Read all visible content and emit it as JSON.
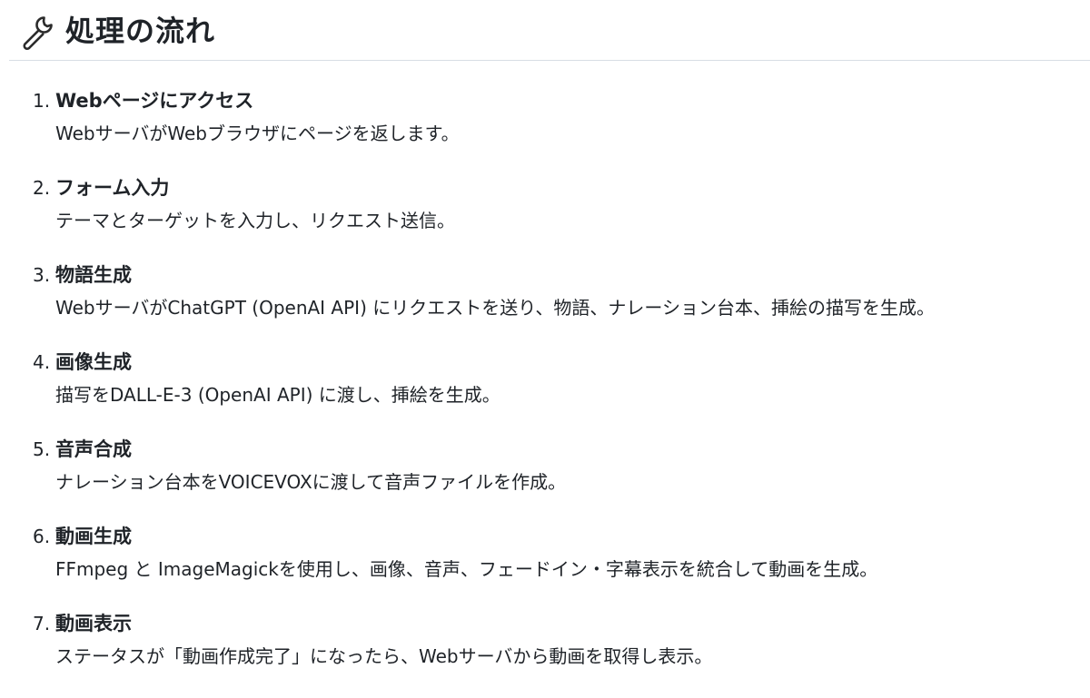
{
  "section": {
    "icon": "wrench-icon",
    "title": "処理の流れ"
  },
  "steps": [
    {
      "number": "1.",
      "title": "Webページにアクセス",
      "description": "WebサーバがWebブラウザにページを返します。"
    },
    {
      "number": "2.",
      "title": "フォーム入力",
      "description": "テーマとターゲットを入力し、リクエスト送信。"
    },
    {
      "number": "3.",
      "title": "物語生成",
      "description": "WebサーバがChatGPT (OpenAI API) にリクエストを送り、物語、ナレーション台本、挿絵の描写を生成。"
    },
    {
      "number": "4.",
      "title": "画像生成",
      "description": "描写をDALL-E-3 (OpenAI API) に渡し、挿絵を生成。"
    },
    {
      "number": "5.",
      "title": "音声合成",
      "description": "ナレーション台本をVOICEVOXに渡して音声ファイルを作成。"
    },
    {
      "number": "6.",
      "title": "動画生成",
      "description": "FFmpeg と ImageMagickを使用し、画像、音声、フェードイン・字幕表示を統合して動画を生成。"
    },
    {
      "number": "7.",
      "title": "動画表示",
      "description": "ステータスが「動画作成完了」になったら、Webサーバから動画を取得し表示。"
    }
  ]
}
